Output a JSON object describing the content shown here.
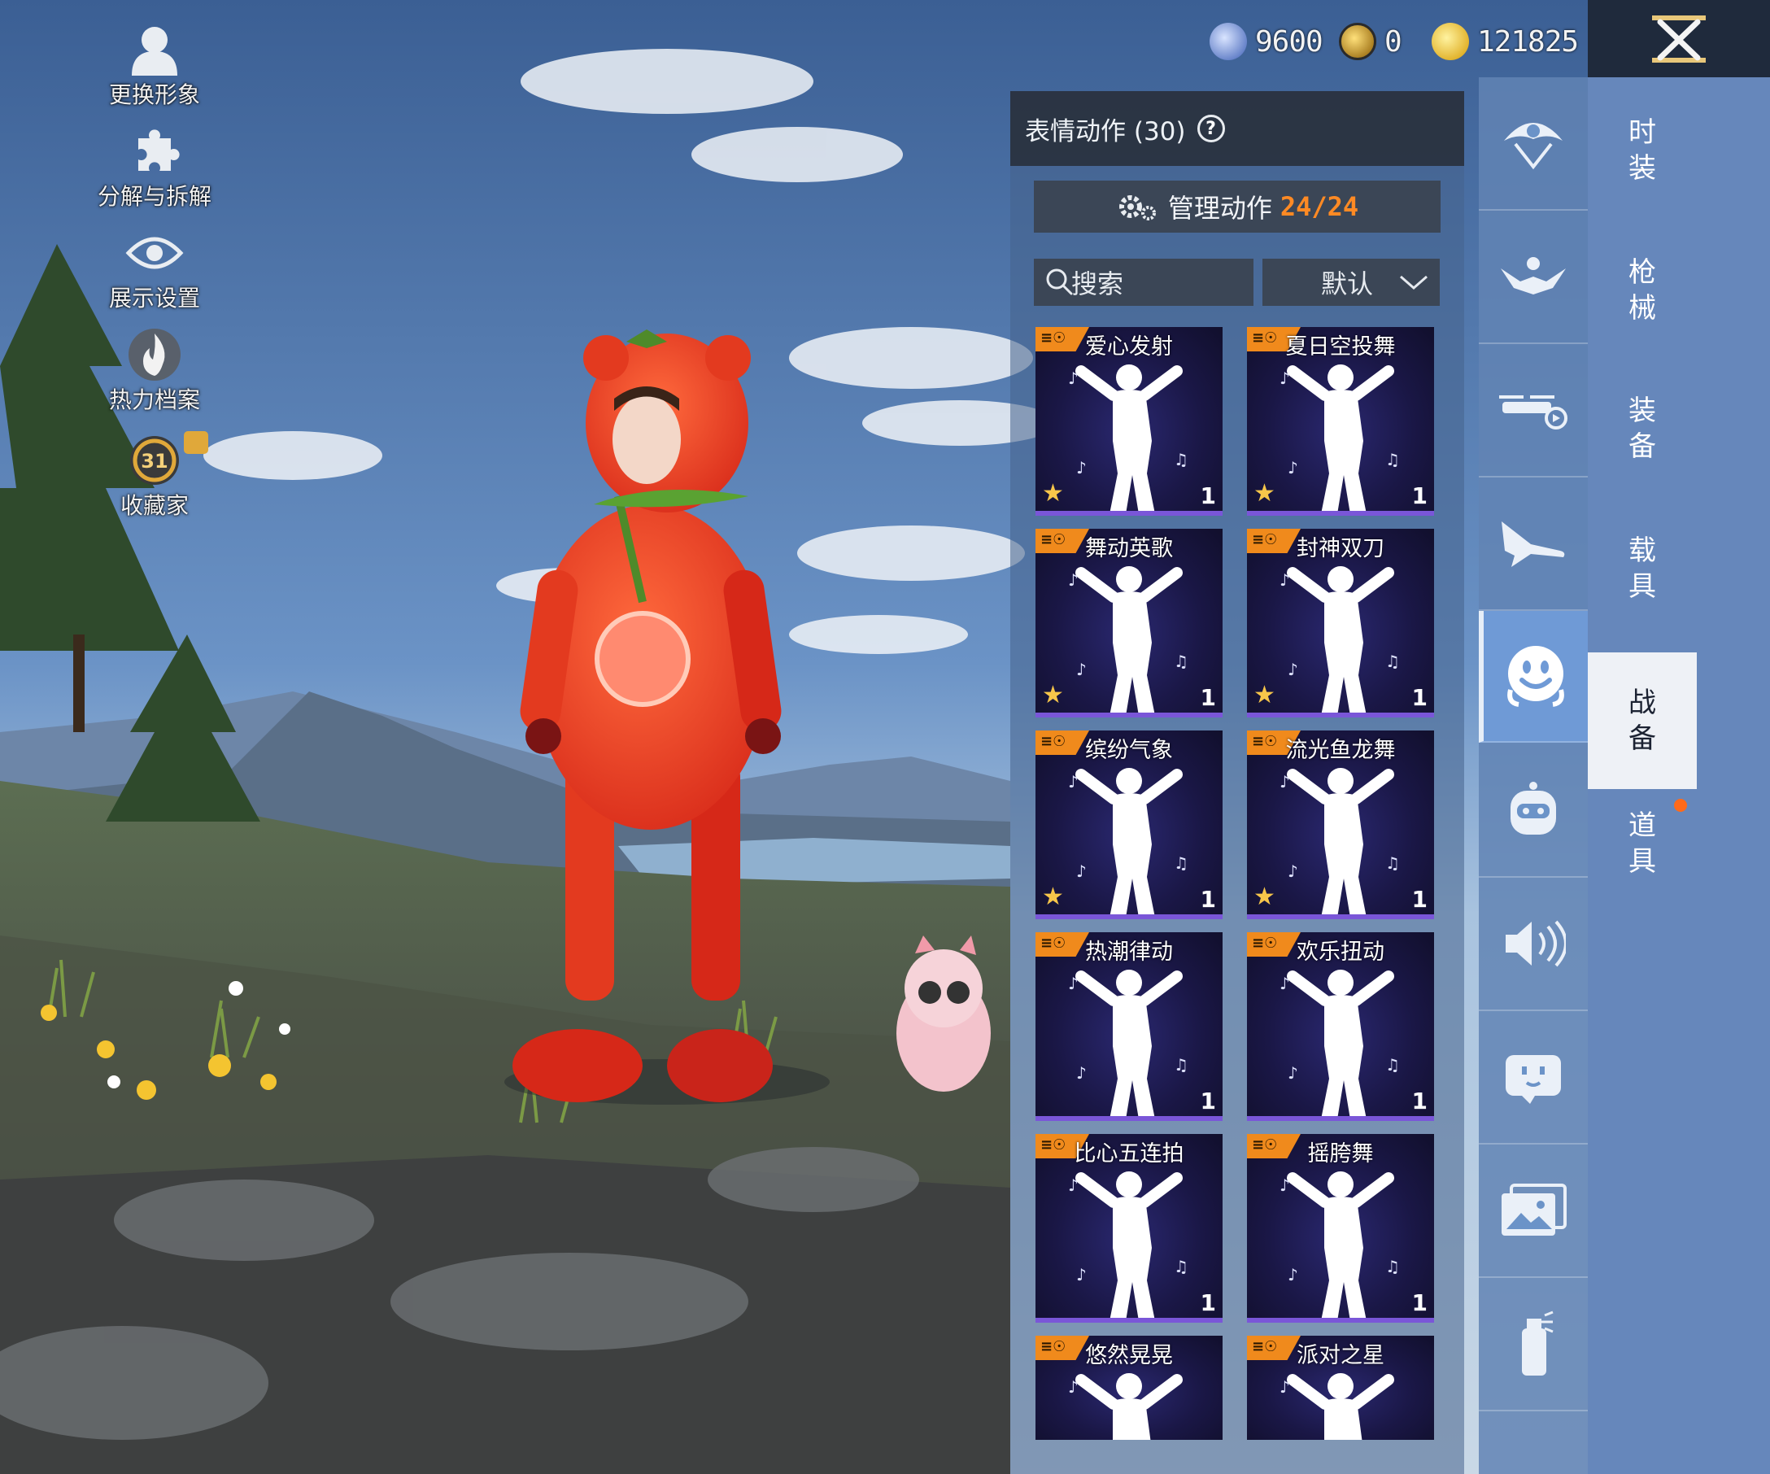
{
  "left_menu": [
    {
      "label": "更换形象",
      "icon": "avatar-icon"
    },
    {
      "label": "分解与拆解",
      "icon": "puzzle-icon"
    },
    {
      "label": "展示设置",
      "icon": "eye-icon"
    },
    {
      "label": "热力档案",
      "icon": "flame-icon"
    },
    {
      "label": "收藏家",
      "icon": "collector-badge-icon",
      "badge": "31"
    }
  ],
  "currency": [
    {
      "icon": "token-coin-icon",
      "value": "9600"
    },
    {
      "icon": "gold-badge-coin-icon",
      "value": "0"
    },
    {
      "icon": "lightning-coin-icon",
      "value": "121825"
    }
  ],
  "panel": {
    "title": "表情动作 (30)",
    "help": "?",
    "manage_label": "管理动作",
    "manage_count": "24/24",
    "search_placeholder": "搜索",
    "sort_label": "默认"
  },
  "emotes": [
    {
      "name": "爱心发射",
      "qty": "1",
      "star": true
    },
    {
      "name": "夏日空投舞",
      "qty": "1",
      "star": true
    },
    {
      "name": "舞动英歌",
      "qty": "1",
      "star": true
    },
    {
      "name": "封神双刀",
      "qty": "1",
      "star": true
    },
    {
      "name": "缤纷气象",
      "qty": "1",
      "star": true
    },
    {
      "name": "流光鱼龙舞",
      "qty": "1",
      "star": true
    },
    {
      "name": "热潮律动",
      "qty": "1",
      "star": false
    },
    {
      "name": "欢乐扭动",
      "qty": "1",
      "star": false
    },
    {
      "name": "比心五连拍",
      "qty": "1",
      "star": false
    },
    {
      "name": "摇胯舞",
      "qty": "1",
      "star": false
    },
    {
      "name": "悠然晃晃",
      "qty": "",
      "star": false
    },
    {
      "name": "派对之星",
      "qty": "",
      "star": false
    }
  ],
  "categories": [
    {
      "icon": "parachute-icon"
    },
    {
      "icon": "skydive-icon"
    },
    {
      "icon": "drone-icon"
    },
    {
      "icon": "airplane-icon"
    },
    {
      "icon": "emote-face-icon",
      "active": true
    },
    {
      "icon": "companion-robot-icon"
    },
    {
      "icon": "speaker-icon"
    },
    {
      "icon": "chat-bubble-icon"
    },
    {
      "icon": "photo-icon"
    },
    {
      "icon": "spray-can-icon"
    }
  ],
  "tabs": [
    {
      "label": "时装"
    },
    {
      "label": "枪械"
    },
    {
      "label": "装备"
    },
    {
      "label": "载具"
    },
    {
      "label": "战备",
      "active": true
    },
    {
      "label": "道具"
    }
  ],
  "colors": {
    "accent": "#ff8a24",
    "tag": "#f08a1c",
    "active_tab": "#eef1f6"
  }
}
